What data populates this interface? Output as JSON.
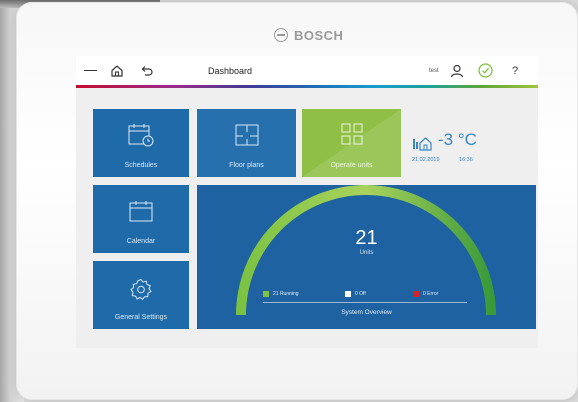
{
  "brand": {
    "name": "BOSCH"
  },
  "topbar": {
    "title": "Dashboard",
    "user": "test",
    "help": "?"
  },
  "tiles": {
    "schedules": "Schedules",
    "floor_plans": "Floor plans",
    "operate_units": "Operate units",
    "calendar": "Calendar",
    "general_settings": "General Settings"
  },
  "weather": {
    "temperature": "-3 °C",
    "date": "21.02.2019",
    "time": "16:36"
  },
  "overview": {
    "count": "21",
    "units_label": "Units",
    "running": "21 Running",
    "off": "0 Off",
    "error": "0 Error",
    "title": "System Overview"
  },
  "colors": {
    "tile_blue": "#1f6ba9",
    "tile_green": "#8fbf45",
    "panel_blue": "#1e62a1",
    "running": "#7cc242",
    "off": "#ffffff",
    "error": "#d2232a",
    "check": "#7cc242"
  },
  "icons": {
    "menu": "hamburger-menu-icon",
    "home": "home-icon",
    "back": "back-arrow-icon",
    "user": "user-icon",
    "status": "check-circle-icon",
    "schedules": "calendar-clock-icon",
    "floor_plans": "floor-plan-icon",
    "operate_units": "grid-units-icon",
    "calendar": "calendar-icon",
    "settings": "gear-icon",
    "weather_home": "home-thermometer-icon"
  }
}
